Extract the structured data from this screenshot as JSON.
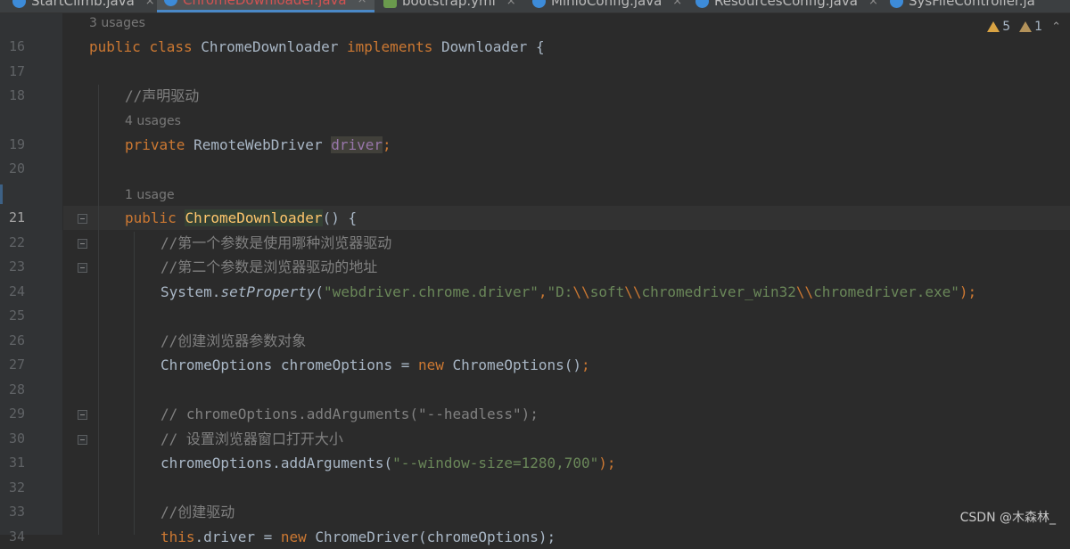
{
  "tabs": [
    {
      "label": "StartClimb.java",
      "icon": "java-class-icon",
      "state": "normal"
    },
    {
      "label": "ChromeDownloader.java",
      "icon": "java-class-icon",
      "state": "active"
    },
    {
      "label": "bootstrap.yml",
      "icon": "yml-file-icon",
      "state": "normal"
    },
    {
      "label": "MinioConfig.java",
      "icon": "java-class-icon",
      "state": "normal"
    },
    {
      "label": "ResourcesConfig.java",
      "icon": "java-class-icon",
      "state": "normal"
    },
    {
      "label": "SysFileController.ja",
      "icon": "java-class-icon",
      "state": "normal"
    }
  ],
  "close_glyph": "×",
  "inspection": {
    "warnings": "5",
    "weak_warnings": "1",
    "chevron": "⌃"
  },
  "hints": {
    "class_usages": "3 usages",
    "driver_usages": "4 usages",
    "ctor_usages": "1 usage"
  },
  "line_numbers": [
    "16",
    "17",
    "18",
    "19",
    "20",
    "21",
    "22",
    "23",
    "24",
    "25",
    "26",
    "27",
    "28",
    "29",
    "30",
    "31",
    "32",
    "33",
    "34"
  ],
  "code": {
    "l16": {
      "kw1": "public",
      "kw2": "class",
      "name": "ChromeDownloader",
      "kw3": "implements",
      "iface": "Downloader {"
    },
    "l18": {
      "comment": "//声明驱动"
    },
    "l19": {
      "kw": "private",
      "type": "RemoteWebDriver",
      "field": "driver",
      "semi": ";"
    },
    "l21": {
      "kw": "public",
      "name": "ChromeDownloader",
      "rest": "() {"
    },
    "l22": {
      "comment": "//第一个参数是使用哪种浏览器驱动"
    },
    "l23": {
      "comment": "//第二个参数是浏览器驱动的地址"
    },
    "l24": {
      "obj": "System.",
      "method": "setProperty",
      "open": "(",
      "arg1": "\"webdriver.chrome.driver\"",
      "comma": ",",
      "s1": "\"D:",
      "e1": "\\\\",
      "s2": "soft",
      "e2": "\\\\",
      "s3": "chromedriver_win32",
      "e3": "\\\\",
      "s4": "chromedriver.exe\"",
      "close": ");"
    },
    "l26": {
      "comment": "//创建浏览器参数对象"
    },
    "l27": {
      "type": "ChromeOptions chromeOptions = ",
      "kw": "new",
      "rest": " ChromeOptions()",
      "semi": ";"
    },
    "l29": {
      "comment": "// chromeOptions.addArguments(\"--headless\");"
    },
    "l30": {
      "comment": "// 设置浏览器窗口打开大小"
    },
    "l31": {
      "call": "chromeOptions.addArguments(",
      "arg": "\"--window-size=1280,700\"",
      "close": ");"
    },
    "l33": {
      "comment": "//创建驱动"
    },
    "l34": {
      "kw": "this",
      "rest": ".driver = ",
      "kw2": "new",
      "rest2": " ChromeDriver(chromeOptions);"
    }
  },
  "watermark": "CSDN @木森林_"
}
